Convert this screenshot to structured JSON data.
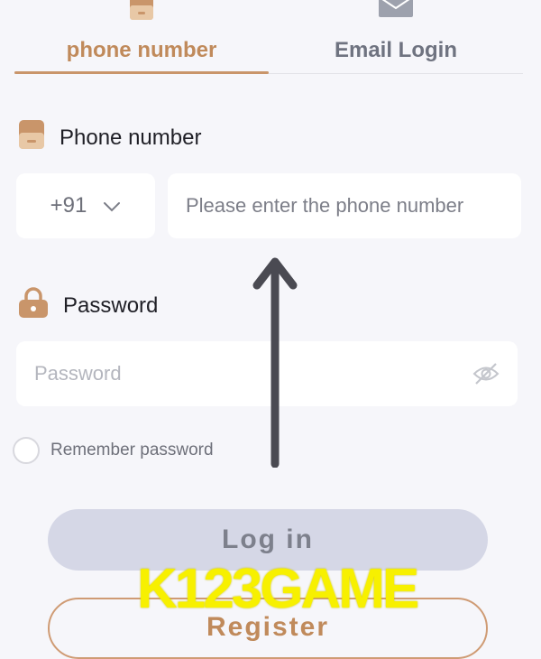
{
  "tabs": {
    "phone_label": "phone number",
    "email_label": "Email Login",
    "active": "phone"
  },
  "phone": {
    "label": "Phone number",
    "country_code": "+91",
    "placeholder": "Please enter the phone number"
  },
  "password": {
    "label": "Password",
    "placeholder": "Password"
  },
  "remember": {
    "label": "Remember password",
    "checked": false
  },
  "buttons": {
    "login_label": "Log in",
    "register_label": "Register"
  },
  "watermark": "K123GAME",
  "colors": {
    "accent": "#c08a5b",
    "background": "#f6f6fa",
    "login_button": "#d5d7e6",
    "watermark": "#f7f000"
  },
  "icons": {
    "phone_tab": "phone-icon",
    "email_tab": "envelope-icon",
    "phone_field": "phone-icon",
    "password_field": "lock-icon",
    "password_toggle": "eye-slash-icon",
    "country_dropdown": "chevron-down-icon",
    "annotation": "arrow-up-icon"
  }
}
